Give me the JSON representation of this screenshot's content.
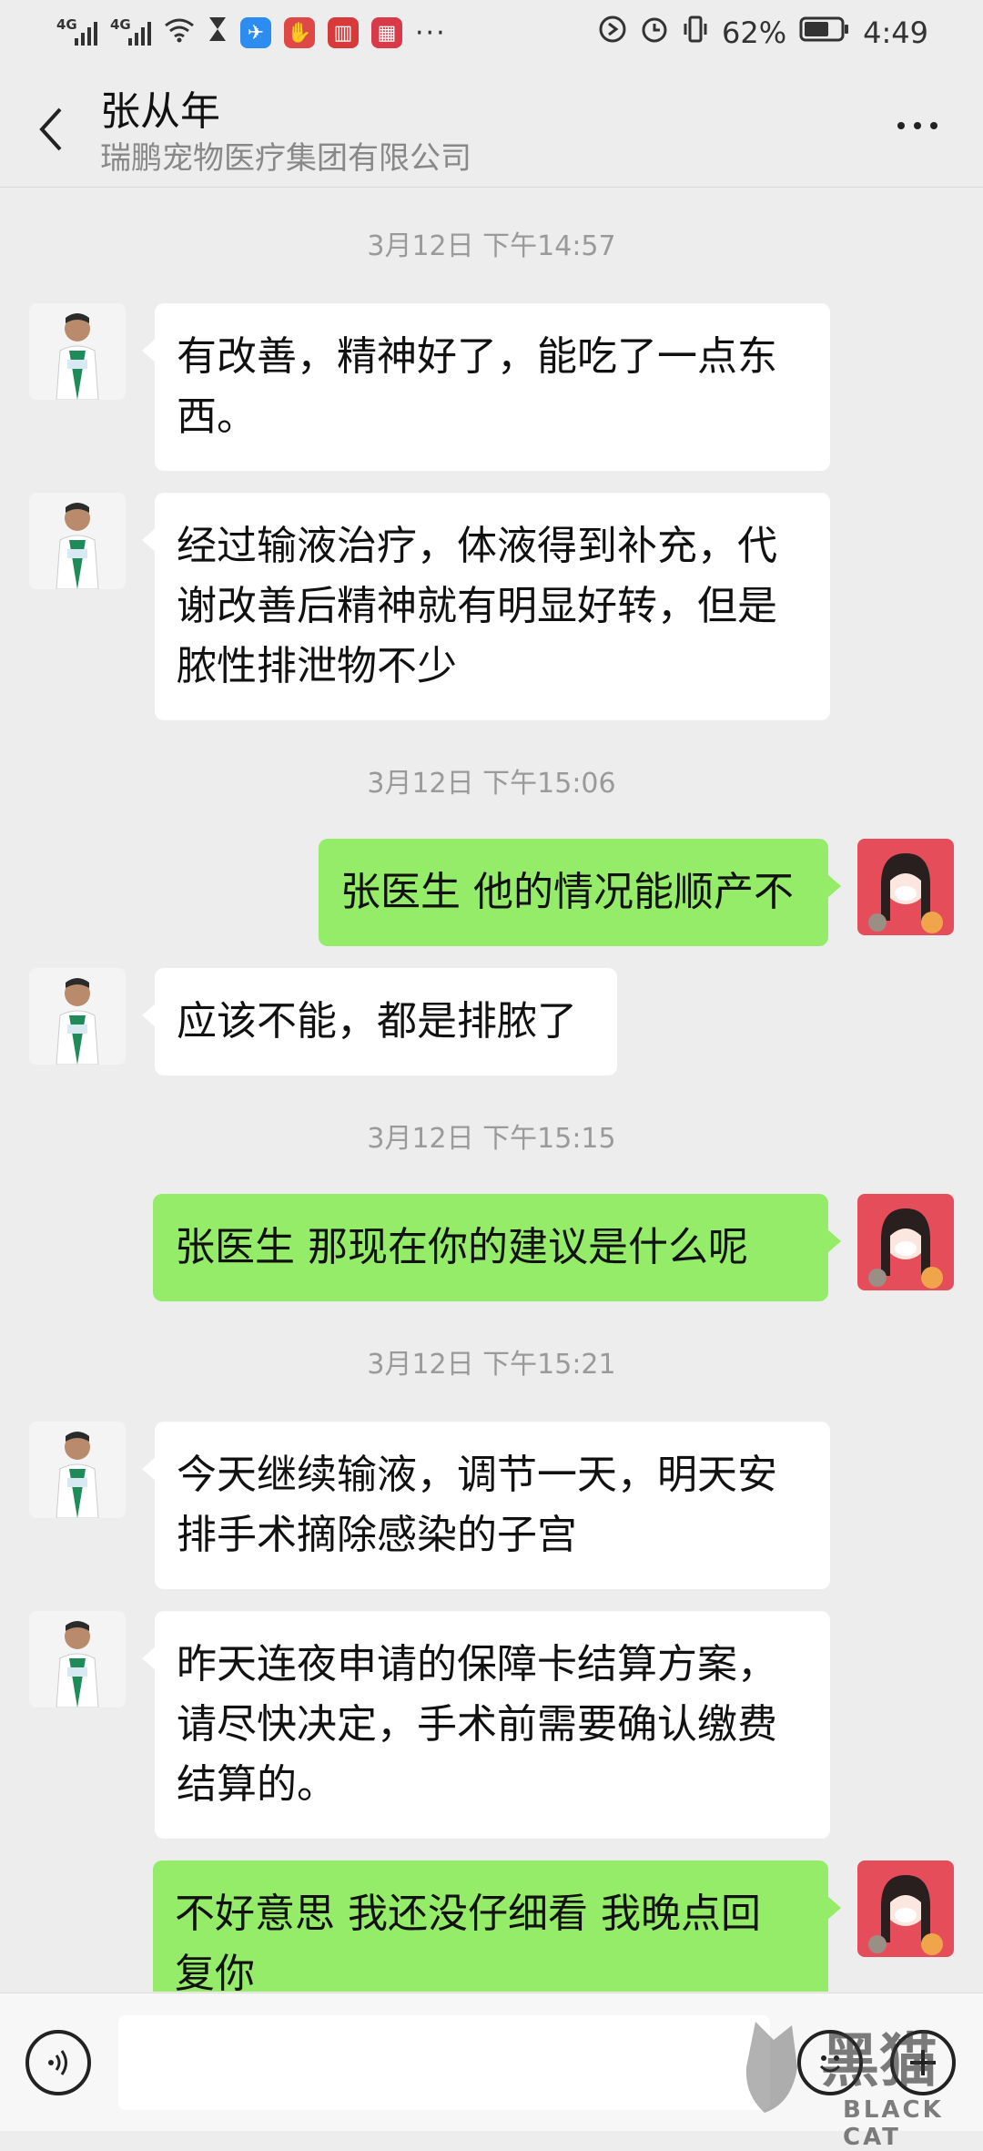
{
  "status_bar": {
    "network1": "4G",
    "network2": "4G",
    "battery": "62%",
    "time": "4:49"
  },
  "header": {
    "title": "张从年",
    "subtitle": "瑞鹏宠物医疗集团有限公司"
  },
  "timestamps": [
    "3月12日 下午14:57",
    "3月12日 下午15:06",
    "3月12日 下午15:15",
    "3月12日 下午15:21"
  ],
  "messages": [
    {
      "from": "doctor",
      "lines": [
        "有改善，精神好了，能吃了一点东",
        "西。"
      ]
    },
    {
      "from": "doctor",
      "lines": [
        "经过输液治疗，体液得到补充，代",
        "谢改善后精神就有明显好转，但是",
        "脓性排泄物不少"
      ]
    },
    {
      "from": "me",
      "lines": [
        "张医生 他的情况能顺产不"
      ]
    },
    {
      "from": "doctor",
      "lines": [
        "应该不能，都是排脓了"
      ]
    },
    {
      "from": "me",
      "lines": [
        "张医生  那现在你的建议是什么呢"
      ]
    },
    {
      "from": "doctor",
      "lines": [
        "今天继续输液，调节一天，明天安",
        "排手术摘除感染的子宫"
      ]
    },
    {
      "from": "doctor",
      "lines": [
        "昨天连夜申请的保障卡结算方案，",
        "请尽快决定，手术前需要确认缴费",
        "结算的。"
      ]
    },
    {
      "from": "me",
      "lines": [
        "不好意思   我还没仔细看  我晚点回",
        "复你"
      ]
    }
  ],
  "watermark": {
    "chinese": "黑猫",
    "english": "BLACK CAT"
  },
  "colors": {
    "background": "#ededed",
    "incoming_bubble": "#ffffff",
    "outgoing_bubble": "#95ec69"
  }
}
